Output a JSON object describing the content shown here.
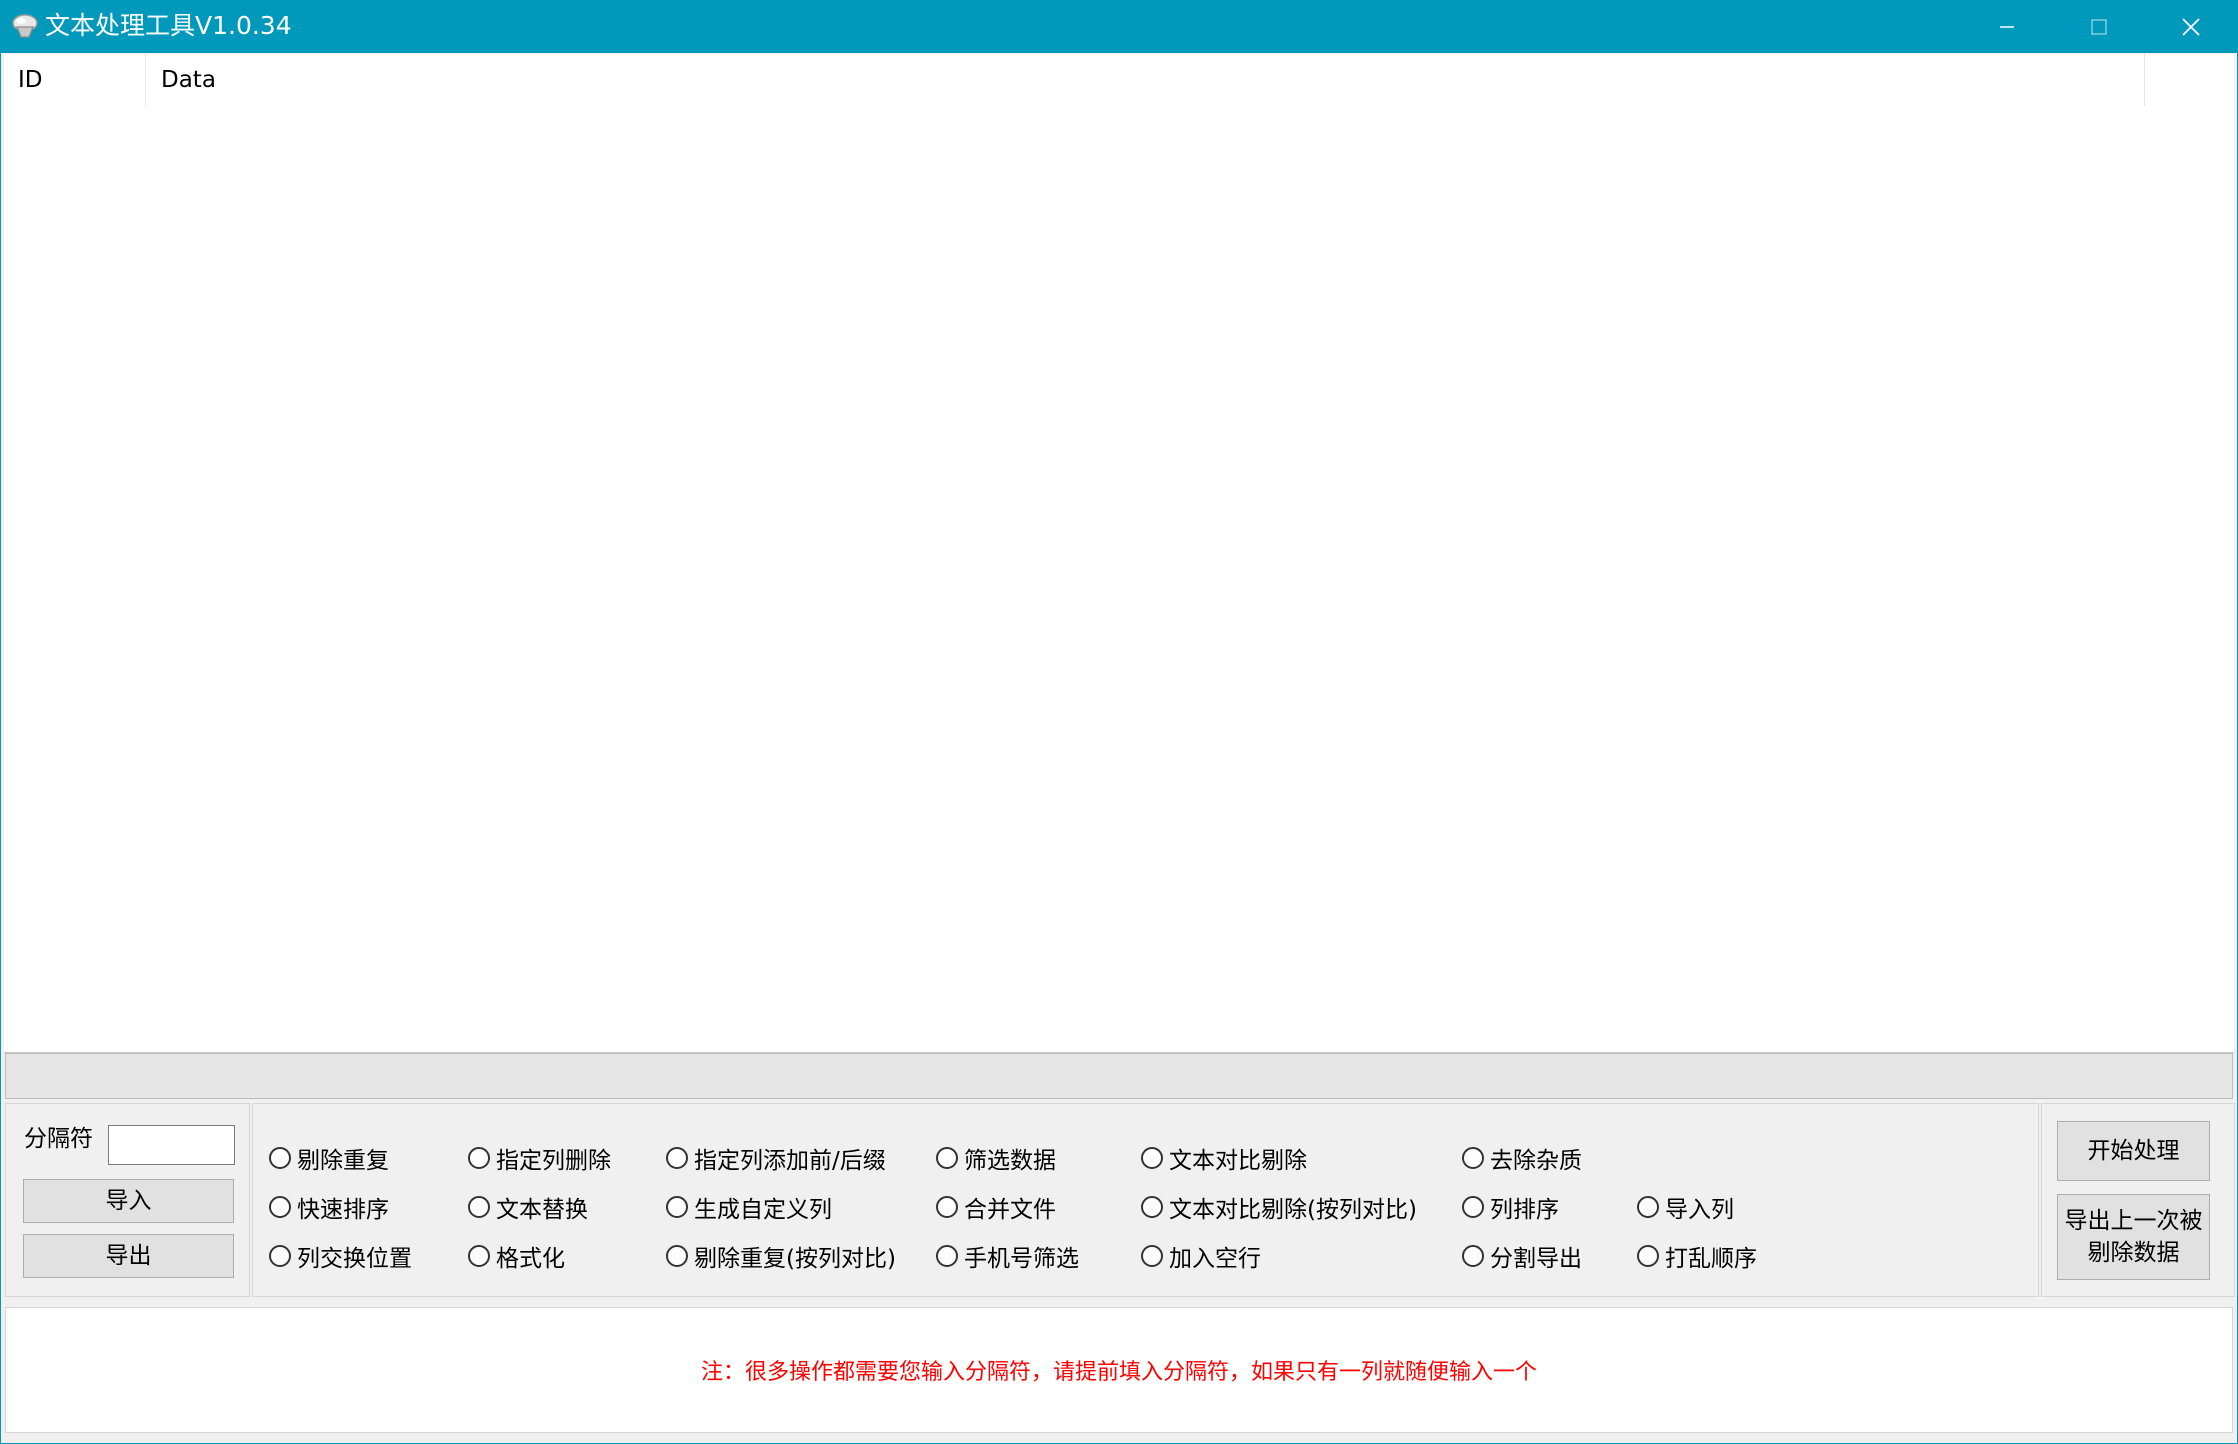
{
  "window": {
    "title": "文本处理工具V1.0.34",
    "accent_color": "#0099bc",
    "controls": [
      "minimize-icon",
      "maximize-icon",
      "close-icon"
    ]
  },
  "listview": {
    "columns": [
      "ID",
      "Data"
    ],
    "rows": []
  },
  "left_panel": {
    "separator_label": "分隔符",
    "separator_value": "",
    "import_label": "导入",
    "export_label": "导出"
  },
  "operations": {
    "row1": [
      "剔除重复",
      "指定列删除",
      "指定列添加前/后缀",
      "筛选数据",
      "文本对比剔除",
      "去除杂质"
    ],
    "row2": [
      "快速排序",
      "文本替换",
      "生成自定义列",
      "合并文件",
      "文本对比剔除(按列对比)",
      "列排序",
      "导入列"
    ],
    "row3": [
      "列交换位置",
      "格式化",
      "剔除重复(按列对比)",
      "手机号筛选",
      "加入空行",
      "分割导出",
      "打乱顺序"
    ]
  },
  "right_panel": {
    "start_label": "开始处理",
    "export_last_label": "导出上一次被剔除数据"
  },
  "notice": {
    "text": "注：很多操作都需要您输入分隔符，请提前填入分隔符，如果只有一列就随便输入一个",
    "color": "#ff0000"
  }
}
